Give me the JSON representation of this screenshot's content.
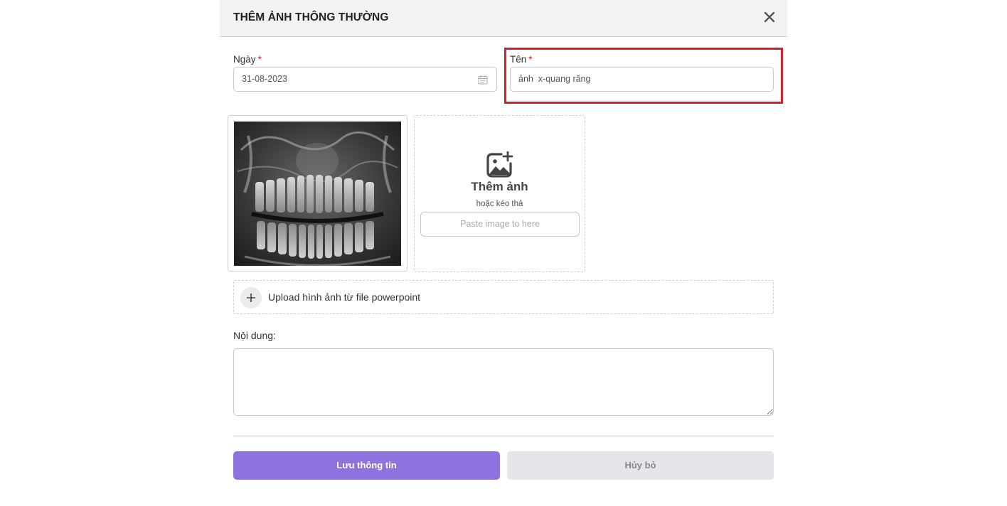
{
  "modal": {
    "title": "THÊM ẢNH THÔNG THƯỜNG",
    "close_icon": "close-icon"
  },
  "form": {
    "date": {
      "label": "Ngày",
      "required_mark": "*",
      "value": "31-08-2023",
      "icon": "calendar-icon"
    },
    "name": {
      "label": "Tên",
      "required_mark": "*",
      "value": "ảnh  x-quang răng"
    },
    "images": [
      {
        "alt": "dental panoramic x-ray"
      }
    ],
    "drop_zone": {
      "icon": "add-image-icon",
      "title": "Thêm ảnh",
      "subtitle": "hoặc kéo thả",
      "paste_placeholder": "Paste image to here"
    },
    "upload_ppt": {
      "icon": "plus-icon",
      "label": "Upload hình ảnh từ file powerpoint"
    },
    "content": {
      "label": "Nội dung:",
      "value": ""
    }
  },
  "actions": {
    "save_label": "Lưu thông tin",
    "cancel_label": "Hủy bỏ"
  },
  "colors": {
    "accent": "#8c73e0",
    "required": "#e02020",
    "highlight": "#d0202a",
    "header_bg": "#f2f2f2"
  }
}
